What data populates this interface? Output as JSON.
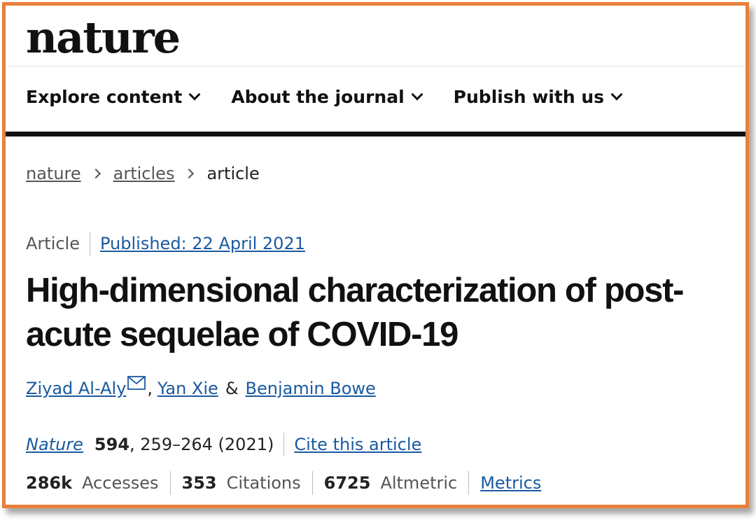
{
  "site": {
    "logo": "nature"
  },
  "nav": [
    {
      "label": "Explore content"
    },
    {
      "label": "About the journal"
    },
    {
      "label": "Publish with us"
    }
  ],
  "breadcrumb": [
    {
      "label": "nature"
    },
    {
      "label": "articles"
    },
    {
      "label": "article"
    }
  ],
  "article": {
    "type": "Article",
    "published": "Published: 22 April 2021",
    "title": "High-dimensional characterization of post-acute sequelae of COVID-19",
    "authors": [
      "Ziyad Al-Aly",
      "Yan Xie",
      "Benjamin Bowe"
    ],
    "author_sep_comma": ",",
    "author_sep_amp": "&",
    "journal": "Nature",
    "volume": "594",
    "pages_year": ", 259–264 (2021)",
    "cite_label": "Cite this article"
  },
  "metrics": {
    "accesses_value": "286k",
    "accesses_label": "Accesses",
    "citations_value": "353",
    "citations_label": "Citations",
    "altmetric_value": "6725",
    "altmetric_label": "Altmetric",
    "metrics_link": "Metrics"
  },
  "colors": {
    "frame": "#e8803a",
    "link": "#1a5aa0"
  },
  "icons": {
    "nav_dropdown": "chevron-down-icon",
    "breadcrumb_sep": "chevron-right-icon",
    "author_email": "mail-icon"
  }
}
